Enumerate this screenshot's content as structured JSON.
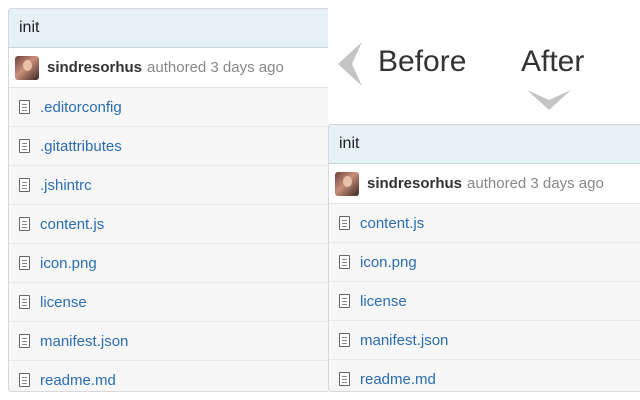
{
  "before": {
    "commit_title": "init",
    "author": "sindresorhus",
    "author_meta": "authored 3 days ago",
    "files": [
      ".editorconfig",
      ".gitattributes",
      ".jshintrc",
      "content.js",
      "icon.png",
      "license",
      "manifest.json",
      "readme.md"
    ]
  },
  "after": {
    "commit_title": "init",
    "author": "sindresorhus",
    "author_meta": "authored 3 days ago",
    "files": [
      "content.js",
      "icon.png",
      "license",
      "manifest.json",
      "readme.md"
    ]
  },
  "labels": {
    "before": "Before",
    "after": "After"
  },
  "icons": {
    "file": "file-text-icon",
    "avatar": "user-avatar",
    "left_arrow": "chevron-left-icon",
    "down_arrow": "chevron-down-icon"
  },
  "colors": {
    "header_bg": "#e6f1f6",
    "link": "#2a6db0",
    "arrow": "#c4c4c4"
  }
}
